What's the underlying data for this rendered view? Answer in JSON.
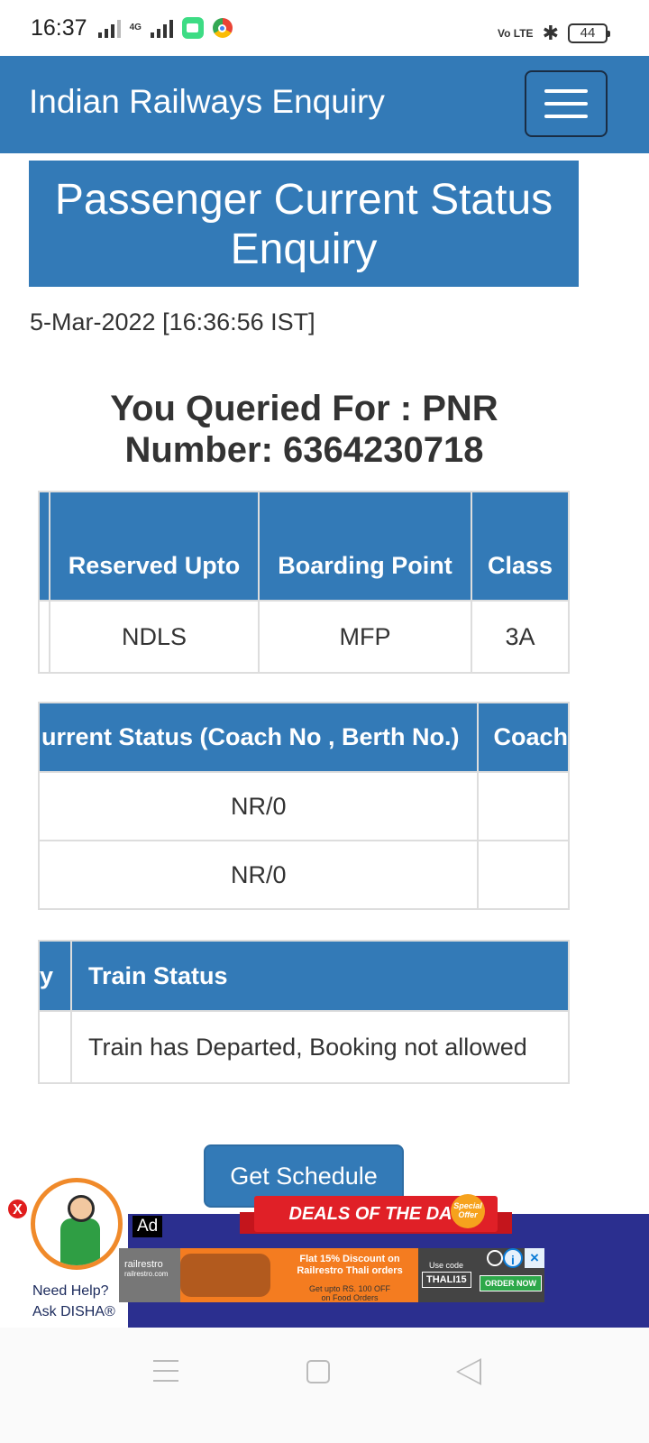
{
  "status_bar": {
    "time": "16:37",
    "network_tag": "4G",
    "volte_tag": "Vo LTE",
    "battery": "44"
  },
  "navbar": {
    "brand": "Indian Railways Enquiry"
  },
  "page": {
    "title_line1": "Passenger Current Status",
    "title_line2": "Enquiry",
    "date": "5-Mar-2022 [16:36:56 IST]",
    "queried_line1": "You Queried For : PNR",
    "queried_line2": "Number: 6364230718"
  },
  "table1": {
    "headers": [
      "Reserved Upto",
      "Boarding Point",
      "Class"
    ],
    "row": [
      "NDLS",
      "MFP",
      "3A"
    ]
  },
  "table2": {
    "headers": [
      "urrent Status (Coach No , Berth No.)",
      "Coach"
    ],
    "rows": [
      [
        "NR/0",
        ""
      ],
      [
        "NR/0",
        ""
      ]
    ]
  },
  "table3": {
    "headers": [
      "y",
      "Train Status"
    ],
    "row": [
      "",
      "Train has Departed, Booking not allowed"
    ]
  },
  "schedule_button": "Get Schedule",
  "ad": {
    "label": "Ad",
    "deals": "DEALS OF THE DAY",
    "special_offer": "Special Offer",
    "brand": "railrestro",
    "brand_site": "railrestro.com",
    "offer_line1": "Flat 15% Discount on",
    "offer_line2": "Railrestro Thali orders",
    "offer_sub1": "Get upto RS. 100 OFF",
    "offer_sub2": "on Food Orders",
    "code_label": "Use code",
    "code": "THALI15",
    "order_now": "ORDER NOW",
    "adchoice": "i",
    "close": "×"
  },
  "disha": {
    "close": "X",
    "line1": "Need Help?",
    "line2": "Ask DISHA®"
  },
  "colors": {
    "primary": "#337ab7",
    "ad_background": "#2b2f8f",
    "deals_red": "#e02027",
    "disha_orange": "#f08a2a"
  }
}
